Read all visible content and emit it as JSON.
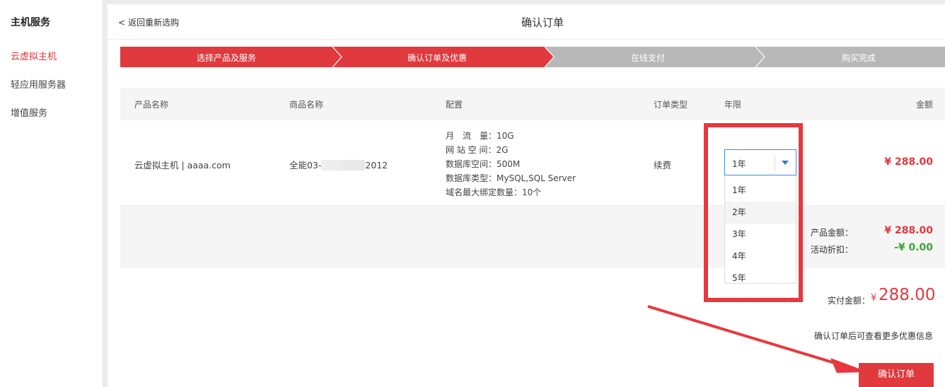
{
  "sidebar": {
    "title": "主机服务",
    "items": [
      "云虚拟主机",
      "轻应用服务器",
      "增值服务"
    ]
  },
  "header": {
    "back_link": "返回重新选购",
    "page_title": "确认订单"
  },
  "steps": [
    "选择产品及服务",
    "确认订单及优惠",
    "在线支付",
    "购买完成"
  ],
  "table": {
    "headers": [
      "产品名称",
      "商品名称",
      "配置",
      "订单类型",
      "年限",
      "金额"
    ],
    "row": {
      "product": "云虚拟主机 | aaaa.com",
      "goods_prefix": "全能03-",
      "goods_suffix": "2012",
      "config": [
        {
          "label": "月　流　量：",
          "value": "10G"
        },
        {
          "label": "网 站 空 间：",
          "value": "2G"
        },
        {
          "label": "数据库空间：",
          "value": "500M"
        },
        {
          "label": "数据库类型：",
          "value": "MySQL,SQL Server"
        },
        {
          "label": "域名最大绑定数量：",
          "value": "10个"
        }
      ],
      "order_type": "续费",
      "term": "1年",
      "amount": "¥ 288.00"
    }
  },
  "term_options": [
    "1年",
    "2年",
    "3年",
    "4年",
    "5年"
  ],
  "summary": {
    "product_amount_label": "产品金额：",
    "product_amount": "¥ 288.00",
    "discount_label": "活动折扣：",
    "discount": "-¥ 0.00"
  },
  "final": {
    "label": "实付金额：",
    "currency": "¥",
    "amount": "288.00",
    "note": "确认订单后可查看更多优惠信息",
    "confirm_button": "确认订单"
  },
  "colors": {
    "accent": "#e0393e",
    "step_inactive": "#b8b8b8",
    "discount_green": "#3ba635",
    "select_blue": "#2d7dd2"
  }
}
